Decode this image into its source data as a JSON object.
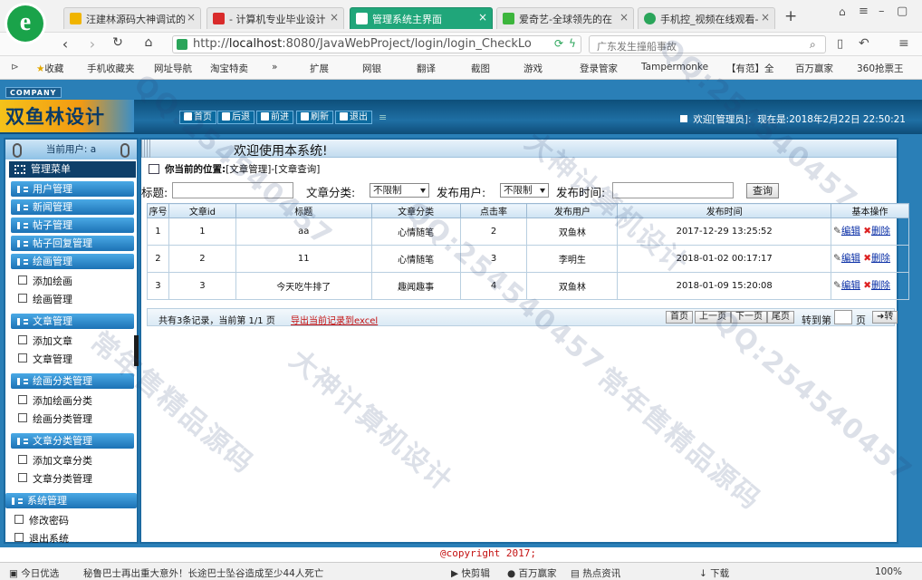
{
  "browser": {
    "tabs": [
      {
        "label": "汪建林源码大神调试的",
        "icon_color": "#f0b400"
      },
      {
        "label": "- 计算机专业毕业设计",
        "icon_color": "#d92b2b"
      },
      {
        "label": "管理系统主界面",
        "icon_color": "#ffffff",
        "active": true
      },
      {
        "label": "爱奇艺-全球领先的在",
        "icon_color": "#3cb53c"
      },
      {
        "label": "手机控_视频在线观看-",
        "icon_color": "#2aa55a"
      }
    ],
    "new_tab": "+",
    "url_prefix": "http://",
    "url_host": "localhost",
    "url_rest": ":8080/JavaWebProject/login/login_CheckLo",
    "search_placeholder": "广东发生撞船事故",
    "bookmarks": [
      "收藏",
      "手机收藏夹",
      "网址导航",
      "淘宝特卖",
      "»",
      "扩展",
      "网银",
      "翻译",
      "截图",
      "游戏",
      "登录管家",
      "Tampermonke",
      "【有范】全",
      "百万赢家",
      "360抢票王"
    ]
  },
  "app": {
    "company_tag": "COMPANY",
    "logo_text": "双鱼林设计",
    "toolbar": [
      "首页",
      "后退",
      "前进",
      "刷新",
      "退出"
    ],
    "welcome_prefix": "欢迎[管理员]:",
    "now_prefix": "现在是:",
    "now_value": "2018年2月22日 22:50:21",
    "current_user_label": "当前用户: a",
    "menu_title": "管理菜单",
    "menu": [
      {
        "group": "用户管理",
        "items": []
      },
      {
        "group": "新闻管理",
        "items": []
      },
      {
        "group": "帖子管理",
        "items": []
      },
      {
        "group": "帖子回复管理",
        "items": []
      },
      {
        "group": "绘画管理",
        "items": [
          "添加绘画",
          "绘画管理"
        ]
      },
      {
        "group": "文章管理",
        "items": [
          "添加文章",
          "文章管理"
        ]
      },
      {
        "group": "绘画分类管理",
        "items": [
          "添加绘画分类",
          "绘画分类管理"
        ]
      },
      {
        "group": "文章分类管理",
        "items": [
          "添加文章分类",
          "文章分类管理"
        ]
      },
      {
        "group": "系统管理",
        "items": [
          "修改密码",
          "退出系统"
        ]
      }
    ],
    "main_welcome": "欢迎使用本系统!",
    "crumb_label": "你当前的位置:",
    "crumb_path": "[文章管理]-[文章查询]",
    "filters": {
      "title_label": "标题:",
      "category_label": "文章分类:",
      "category_value": "不限制",
      "publisher_label": "发布用户:",
      "publisher_value": "不限制",
      "time_label": "发布时间:",
      "search_button": "查询"
    },
    "table": {
      "headers": [
        "序号",
        "文章id",
        "标题",
        "文章分类",
        "点击率",
        "发布用户",
        "发布时间",
        "基本操作"
      ],
      "rows": [
        [
          "1",
          "1",
          "aa",
          "心情随笔",
          "2",
          "双鱼林",
          "2017-12-29 13:25:52"
        ],
        [
          "2",
          "2",
          "11",
          "心情随笔",
          "3",
          "李明生",
          "2018-01-02 00:17:17"
        ],
        [
          "3",
          "3",
          "今天吃牛排了",
          "趣闻趣事",
          "4",
          "双鱼林",
          "2018-01-09 15:20:08"
        ]
      ],
      "edit_label": "编辑",
      "delete_label": "删除"
    },
    "pager": {
      "record_info": "共有3条记录，当前第 1/1 页",
      "export_label": "导出当前记录到excel",
      "buttons": [
        "首页",
        "上一页",
        "下一页",
        "尾页"
      ],
      "jump_label": "转到第",
      "page_suffix": "页",
      "go_label": "转"
    },
    "copyright": "@copyright 2017;"
  },
  "statusbar": {
    "items": [
      "今日优选",
      "秘鲁巴士再出重大意外！长途巴士坠谷造成至少44人死亡",
      "快剪辑",
      "百万赢家",
      "热点资讯",
      "下载",
      "100%"
    ]
  },
  "watermark": [
    "QQ:254540457",
    "大神计算机设计",
    "常年售精品源码"
  ]
}
